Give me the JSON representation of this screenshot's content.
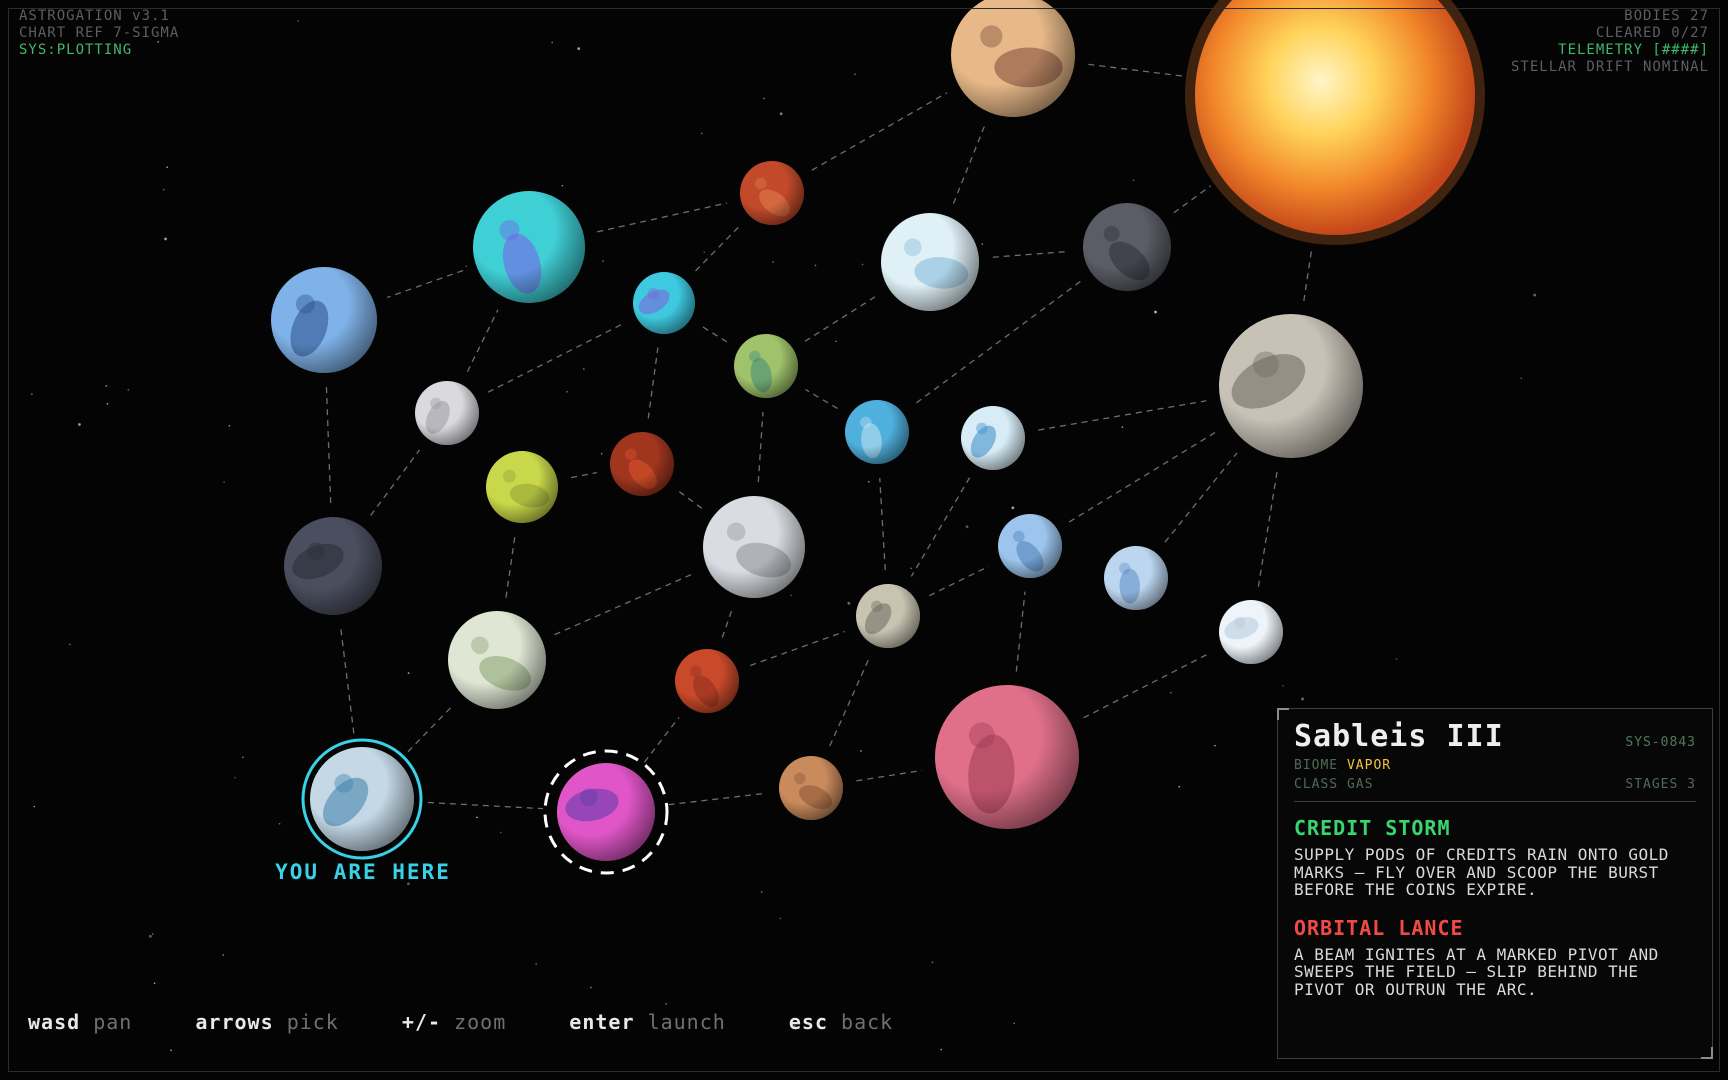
{
  "hud": {
    "left": [
      "ASTROGATION v3.1",
      "CHART REF 7-SIGMA",
      "SYS:PLOTTING"
    ],
    "right": [
      "BODIES 27",
      "CLEARED 0/27",
      "TELEMETRY [####]",
      "STELLAR DRIFT NOMINAL"
    ]
  },
  "map": {
    "current_label": "YOU ARE HERE",
    "colors": {
      "current_ring": "#38d1e6",
      "selected_ring": "#ffffff",
      "route": "#6b6e73"
    }
  },
  "controls": [
    {
      "key": "wasd",
      "action": "pan"
    },
    {
      "key": "arrows",
      "action": "pick"
    },
    {
      "key": "+/-",
      "action": "zoom"
    },
    {
      "key": "enter",
      "action": "launch"
    },
    {
      "key": "esc",
      "action": "back"
    }
  ],
  "panel": {
    "name": "Sableis III",
    "sys": "SYS-0843",
    "biome_label": "BIOME",
    "biome": "VAPOR",
    "class_label": "CLASS",
    "class": "GAS",
    "stages_label": "STAGES",
    "stages": "3",
    "events": [
      {
        "title": "CREDIT STORM",
        "color": "#38d66d",
        "desc": "SUPPLY PODS OF CREDITS RAIN ONTO GOLD MARKS — FLY OVER AND SCOOP THE BURST BEFORE THE COINS EXPIRE."
      },
      {
        "title": "ORBITAL LANCE",
        "color": "#f04a44",
        "desc": "A BEAM IGNITES AT A MARKED PIVOT AND SWEEPS THE FIELD — SLIP BEHIND THE PIVOT OR OUTRUN THE ARC."
      }
    ]
  }
}
